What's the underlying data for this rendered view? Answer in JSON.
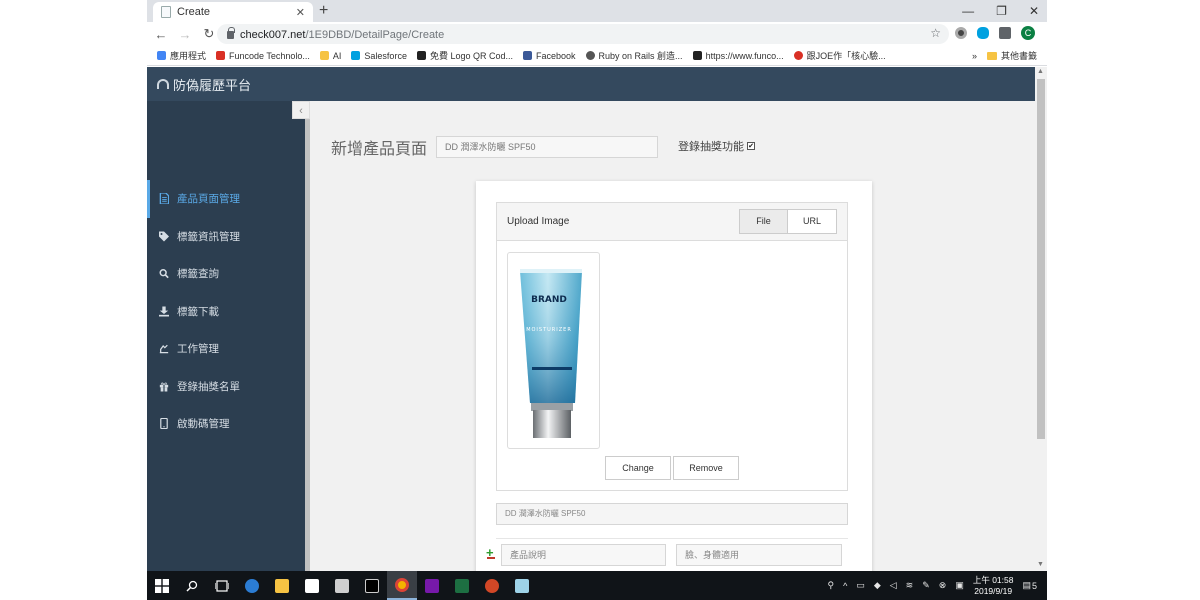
{
  "browser": {
    "tab_title": "Create",
    "tab_close": "✕",
    "new_tab": "+",
    "window_controls": [
      "—",
      "❐",
      "✕"
    ],
    "nav": {
      "back": "←",
      "forward": "→",
      "reload": "↻"
    },
    "url_host": "check007.net",
    "url_path": "/1E9DBD/DetailPage/Create",
    "star": "☆",
    "avatar_letter": "C",
    "kebab": "⋮",
    "bookmarks": [
      {
        "label": "應用程式",
        "color": "#4285f4"
      },
      {
        "label": "Funcode Technolo...",
        "color": "#d93025"
      },
      {
        "label": "AI",
        "color": "#f6c343"
      },
      {
        "label": "Salesforce",
        "color": "#00a1e0"
      },
      {
        "label": "免費 Logo QR Cod...",
        "color": "#222222"
      },
      {
        "label": "Facebook",
        "color": "#3b5998"
      },
      {
        "label": "Ruby on Rails 創造...",
        "color": "#555555"
      },
      {
        "label": "https://www.funco...",
        "color": "#222222"
      },
      {
        "label": "跟JOE作「核心驗...",
        "color": "#d93025"
      }
    ],
    "bookmarks_more": "»",
    "other_bookmarks": "其他書籤"
  },
  "app": {
    "title": "防偽履歷平台",
    "collapse_glyph": "‹",
    "menu": [
      {
        "label": "產品頁面管理",
        "icon": "document-icon",
        "active": true
      },
      {
        "label": "標籤資訊管理",
        "icon": "tag-icon",
        "active": false
      },
      {
        "label": "標籤查詢",
        "icon": "search-icon",
        "active": false
      },
      {
        "label": "標籤下載",
        "icon": "download-icon",
        "active": false
      },
      {
        "label": "工作管理",
        "icon": "work-icon",
        "active": false
      },
      {
        "label": "登錄抽獎名單",
        "icon": "gift-icon",
        "active": false
      },
      {
        "label": "啟動碼管理",
        "icon": "mobile-icon",
        "active": false
      }
    ]
  },
  "page": {
    "title": "新增產品頁面",
    "product_name_value": "DD 潤澤水防曬 SPF50",
    "lottery_label": "登錄抽獎功能",
    "lottery_checked": "✔"
  },
  "upload": {
    "heading": "Upload Image",
    "file_tab": "File",
    "url_tab": "URL",
    "image_brand": "BRAND",
    "image_subtext": "MOISTURIZER",
    "change_label": "Change",
    "remove_label": "Remove"
  },
  "form": {
    "name_field_value": "DD 潤澤水防曬 SPF50",
    "add_glyph": "+",
    "desc_placeholder": "產品說明",
    "usage_placeholder": "臉、身體適用"
  },
  "taskbar": {
    "clock_time": "上午 01:58",
    "clock_date": "2019/9/19",
    "notification_count": "5"
  }
}
